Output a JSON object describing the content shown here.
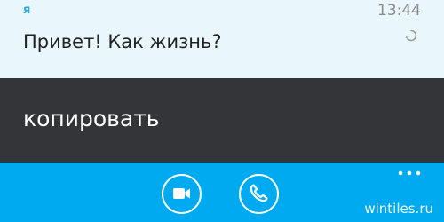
{
  "message": {
    "sender": "я",
    "time": "13:44",
    "text": "Привет! Как жизнь?",
    "status_icon": "sending-spinner-icon"
  },
  "context_menu": {
    "copy_label": "копировать"
  },
  "app_bar": {
    "more_icon": "more-dots-icon",
    "video_call_icon": "video-camera-icon",
    "voice_call_icon": "phone-icon"
  },
  "watermark": {
    "text": "wintiles.ru"
  },
  "colors": {
    "message_bg": "#e9f7fd",
    "menu_bg": "#343538",
    "app_bar_bg": "#00aaf0",
    "sender": "#2aa6e0"
  }
}
